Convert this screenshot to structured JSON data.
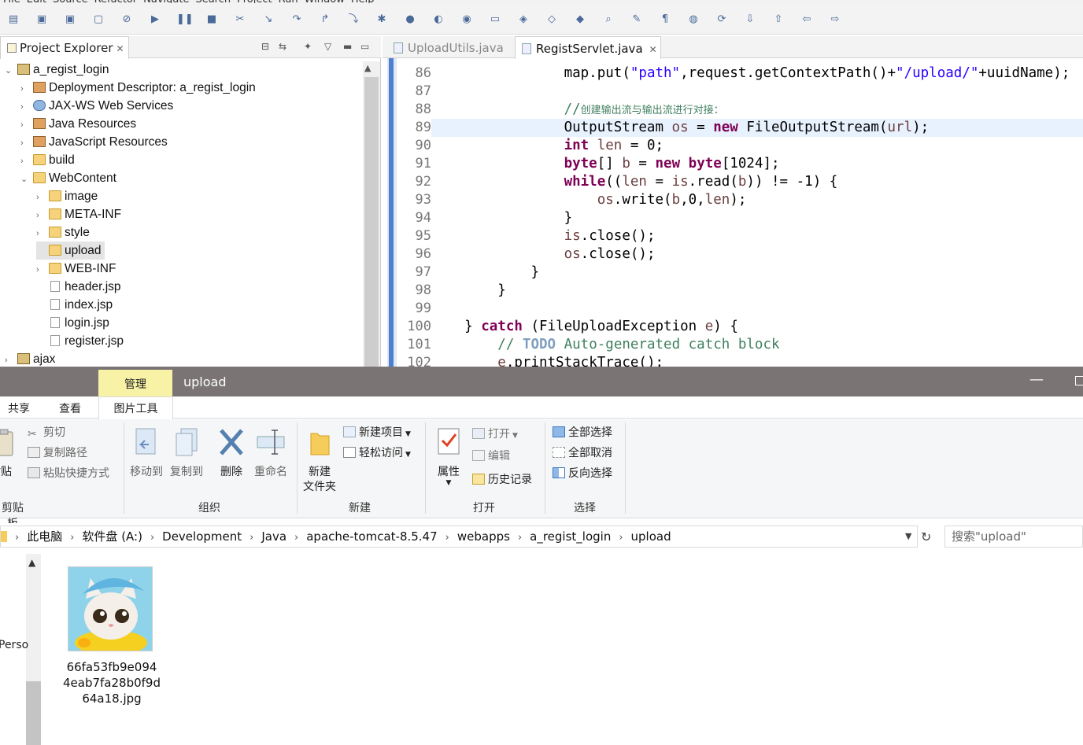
{
  "eclipse": {
    "menu": [
      "File",
      "Edit",
      "Source",
      "Refactor",
      "Navigate",
      "Search",
      "Project",
      "Run",
      "Window",
      "Help"
    ],
    "project_explorer": {
      "tab_label": "Project Explorer",
      "tree": [
        {
          "label": "a_regist_login",
          "depth": 0,
          "twisty": "expanded",
          "icon": "project-icon"
        },
        {
          "label": "Deployment Descriptor: a_regist_login",
          "depth": 1,
          "twisty": "collapsed",
          "icon": "deployment-descriptor-icon"
        },
        {
          "label": "JAX-WS Web Services",
          "depth": 1,
          "twisty": "collapsed",
          "icon": "web-services-icon"
        },
        {
          "label": "Java Resources",
          "depth": 1,
          "twisty": "collapsed",
          "icon": "java-resources-icon"
        },
        {
          "label": "JavaScript Resources",
          "depth": 1,
          "twisty": "collapsed",
          "icon": "javascript-resources-icon"
        },
        {
          "label": "build",
          "depth": 1,
          "twisty": "collapsed",
          "icon": "folder-icon"
        },
        {
          "label": "WebContent",
          "depth": 1,
          "twisty": "expanded",
          "icon": "folder-open-icon"
        },
        {
          "label": "image",
          "depth": 2,
          "twisty": "collapsed",
          "icon": "folder-icon"
        },
        {
          "label": "META-INF",
          "depth": 2,
          "twisty": "collapsed",
          "icon": "folder-icon"
        },
        {
          "label": "style",
          "depth": 2,
          "twisty": "collapsed",
          "icon": "folder-icon"
        },
        {
          "label": "upload",
          "depth": 2,
          "twisty": "none",
          "icon": "folder-icon",
          "selected": true
        },
        {
          "label": "WEB-INF",
          "depth": 2,
          "twisty": "collapsed",
          "icon": "folder-icon"
        },
        {
          "label": "header.jsp",
          "depth": 2,
          "twisty": "none",
          "icon": "jsp-file-icon"
        },
        {
          "label": "index.jsp",
          "depth": 2,
          "twisty": "none",
          "icon": "jsp-file-icon"
        },
        {
          "label": "login.jsp",
          "depth": 2,
          "twisty": "none",
          "icon": "jsp-file-icon"
        },
        {
          "label": "register.jsp",
          "depth": 2,
          "twisty": "none",
          "icon": "jsp-file-icon"
        },
        {
          "label": "ajax",
          "depth": 0,
          "twisty": "collapsed",
          "icon": "project-icon"
        }
      ]
    },
    "editor": {
      "tabs": [
        {
          "label": "UploadUtils.java",
          "active": false
        },
        {
          "label": "RegistServlet.java",
          "active": true
        }
      ],
      "current_line": 89,
      "lines": [
        {
          "n": "86",
          "indent": "                ",
          "segs": [
            [
              "t",
              "map.put("
            ],
            [
              "s",
              "\"path\""
            ],
            [
              "t",
              ",request.getContextPath()+"
            ],
            [
              "s",
              "\"/upload/\""
            ],
            [
              "t",
              "+uuidName);"
            ]
          ]
        },
        {
          "n": "87",
          "indent": "",
          "segs": []
        },
        {
          "n": "88",
          "indent": "                ",
          "segs": [
            [
              "c",
              "//"
            ],
            [
              "cz",
              "创建输出流与输出流进行对接："
            ]
          ]
        },
        {
          "n": "89",
          "indent": "                ",
          "segs": [
            [
              "t",
              "OutputStream "
            ],
            [
              "v",
              "os"
            ],
            [
              "t",
              " = "
            ],
            [
              "k",
              "new"
            ],
            [
              "t",
              " FileOutputStream("
            ],
            [
              "v",
              "url"
            ],
            [
              "t",
              ");"
            ]
          ]
        },
        {
          "n": "90",
          "indent": "                ",
          "segs": [
            [
              "k",
              "int"
            ],
            [
              "t",
              " "
            ],
            [
              "v",
              "len"
            ],
            [
              "t",
              " = 0;"
            ]
          ]
        },
        {
          "n": "91",
          "indent": "                ",
          "segs": [
            [
              "k",
              "byte"
            ],
            [
              "t",
              "[] "
            ],
            [
              "v",
              "b"
            ],
            [
              "t",
              " = "
            ],
            [
              "k",
              "new"
            ],
            [
              "t",
              " "
            ],
            [
              "k",
              "byte"
            ],
            [
              "t",
              "[1024];"
            ]
          ]
        },
        {
          "n": "92",
          "indent": "                ",
          "segs": [
            [
              "k",
              "while"
            ],
            [
              "t",
              "(("
            ],
            [
              "v",
              "len"
            ],
            [
              "t",
              " = "
            ],
            [
              "v",
              "is"
            ],
            [
              "t",
              ".read("
            ],
            [
              "v",
              "b"
            ],
            [
              "t",
              ")) != -1) {"
            ]
          ]
        },
        {
          "n": "93",
          "indent": "                    ",
          "segs": [
            [
              "v",
              "os"
            ],
            [
              "t",
              ".write("
            ],
            [
              "v",
              "b"
            ],
            [
              "t",
              ",0,"
            ],
            [
              "v",
              "len"
            ],
            [
              "t",
              ");"
            ]
          ]
        },
        {
          "n": "94",
          "indent": "                ",
          "segs": [
            [
              "t",
              "}"
            ]
          ]
        },
        {
          "n": "95",
          "indent": "                ",
          "segs": [
            [
              "v",
              "is"
            ],
            [
              "t",
              ".close();"
            ]
          ]
        },
        {
          "n": "96",
          "indent": "                ",
          "segs": [
            [
              "v",
              "os"
            ],
            [
              "t",
              ".close();"
            ]
          ]
        },
        {
          "n": "97",
          "indent": "            ",
          "segs": [
            [
              "t",
              "}"
            ]
          ]
        },
        {
          "n": "98",
          "indent": "        ",
          "segs": [
            [
              "t",
              "}"
            ]
          ]
        },
        {
          "n": "99",
          "indent": "",
          "segs": []
        },
        {
          "n": "100",
          "indent": "    ",
          "segs": [
            [
              "t",
              "} "
            ],
            [
              "k",
              "catch"
            ],
            [
              "t",
              " (FileUploadException "
            ],
            [
              "v",
              "e"
            ],
            [
              "t",
              ") {"
            ]
          ]
        },
        {
          "n": "101",
          "indent": "        ",
          "segs": [
            [
              "c",
              "// "
            ],
            [
              "d",
              "TODO"
            ],
            [
              "c",
              " Auto-generated catch block"
            ]
          ]
        },
        {
          "n": "102",
          "indent": "        ",
          "segs": [
            [
              "v",
              "e"
            ],
            [
              "t",
              ".printStackTrace();"
            ]
          ]
        }
      ]
    }
  },
  "explorer": {
    "title": "upload",
    "context_tab": "管理",
    "ribbon_tabs": [
      "共享",
      "查看"
    ],
    "context_subtab": "图片工具",
    "clipboard": {
      "paste_label": "粘贴",
      "cut": "剪切",
      "copy_path": "复制路径",
      "paste_shortcut": "粘贴快捷方式",
      "group": "剪贴板"
    },
    "organize": {
      "move_to": "移动到",
      "copy_to": "复制到",
      "delete": "删除",
      "rename": "重命名",
      "group": "组织"
    },
    "new_group": {
      "new_folder_line1": "新建",
      "new_folder_line2": "文件夹",
      "new_item": "新建项目",
      "easy_access": "轻松访问",
      "group": "新建"
    },
    "open_group": {
      "properties": "属性",
      "open": "打开",
      "edit": "编辑",
      "history": "历史记录",
      "group": "打开"
    },
    "select_group": {
      "select_all": "全部选择",
      "select_none": "全部取消",
      "invert": "反向选择",
      "group": "选择"
    },
    "breadcrumb": [
      "此电脑",
      "软件盘 (A:)",
      "Development",
      "Java",
      "apache-tomcat-8.5.47",
      "webapps",
      "a_regist_login",
      "upload"
    ],
    "search_placeholder": "搜索\"upload\"",
    "nav_item_partial": "Perso",
    "file": {
      "name": "66fa53fb9e0944eab7fa28b0f9d64a18.jpg",
      "icon": "cat-thumbnail-image"
    }
  }
}
